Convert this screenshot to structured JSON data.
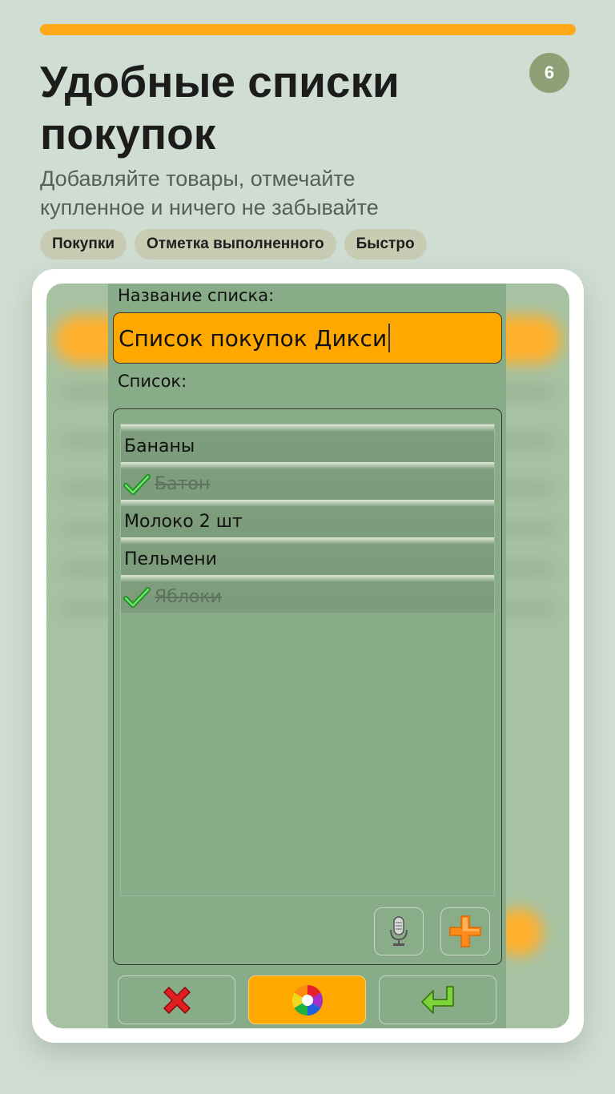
{
  "page_number": "6",
  "headline": "Удобные списки покупок",
  "subtitle": "Добавляйте товары, отмечайте купленное и ничего не забывайте",
  "chips": [
    "Покупки",
    "Отметка выполненного",
    "Быстро"
  ],
  "colors": {
    "accent": "#ffa800",
    "dialog_bg": "#88ac88",
    "page_bg": "#d0ddd3"
  },
  "dialog": {
    "name_label": "Название списка:",
    "name_value": "Список покупок Дикси",
    "list_label": "Список:",
    "items": [
      {
        "text": "Бананы",
        "done": false
      },
      {
        "text": "Батон",
        "done": true
      },
      {
        "text": "Молоко 2 шт",
        "done": false
      },
      {
        "text": "Пельмени",
        "done": false
      },
      {
        "text": "Яблоки",
        "done": true
      }
    ],
    "mini_buttons": [
      "microphone-icon",
      "plus-icon"
    ],
    "bottom_buttons": [
      "close-icon",
      "color-wheel-icon",
      "enter-arrow-icon"
    ]
  }
}
